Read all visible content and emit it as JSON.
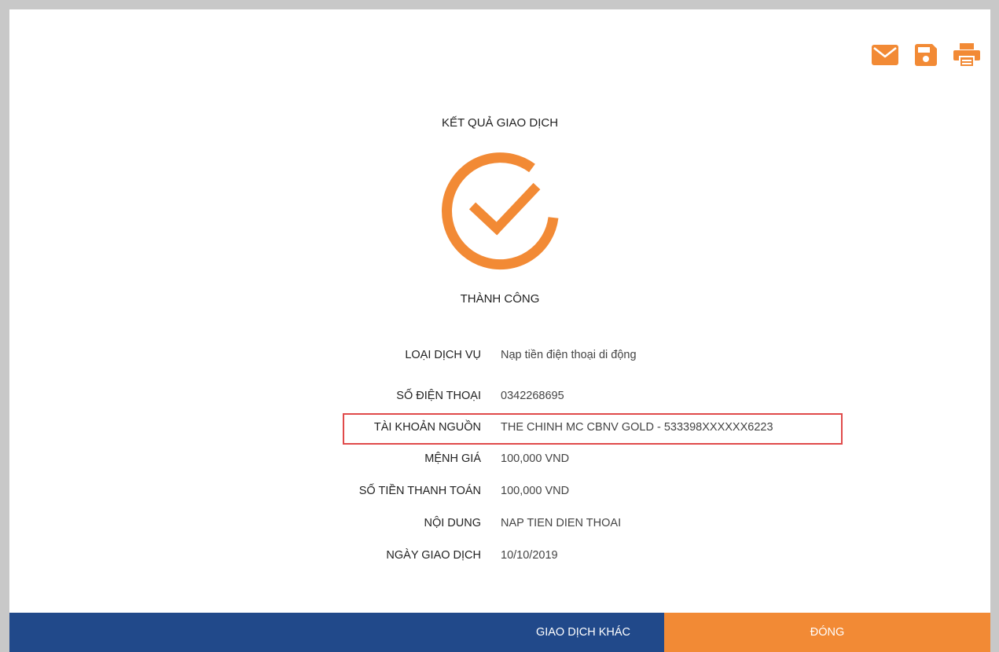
{
  "toolbar": {
    "email_icon": "envelope-icon",
    "save_icon": "floppy-disk-icon",
    "print_icon": "printer-icon",
    "icon_color": "#f28a35"
  },
  "header": {
    "title": "KẾT QUẢ GIAO DỊCH"
  },
  "status": {
    "icon": "check-circle-icon",
    "text": "THÀNH CÔNG",
    "color": "#f28a35"
  },
  "details": [
    {
      "label": "LOẠI DỊCH VỤ",
      "value": "Nạp tiền điện thoại di động"
    },
    {
      "label": "SỐ ĐIỆN THOẠI",
      "value": "0342268695"
    },
    {
      "label": "TÀI KHOẢN NGUỒN",
      "value": "THE CHINH MC CBNV GOLD - 533398XXXXXX6223"
    },
    {
      "label": "MỆNH GIÁ",
      "value": "100,000 VND"
    },
    {
      "label": "SỐ TIỀN THANH TOÁN",
      "value": "100,000 VND"
    },
    {
      "label": "NỘI DUNG",
      "value": "NAP TIEN DIEN THOAI"
    },
    {
      "label": "NGÀY GIAO DỊCH",
      "value": "10/10/2019"
    }
  ],
  "highlight": {
    "color": "#e04a4a"
  },
  "footer": {
    "other_label": "GIAO DỊCH KHÁC",
    "close_label": "ĐÓNG",
    "other_color": "#21498a",
    "close_color": "#f28a35"
  }
}
